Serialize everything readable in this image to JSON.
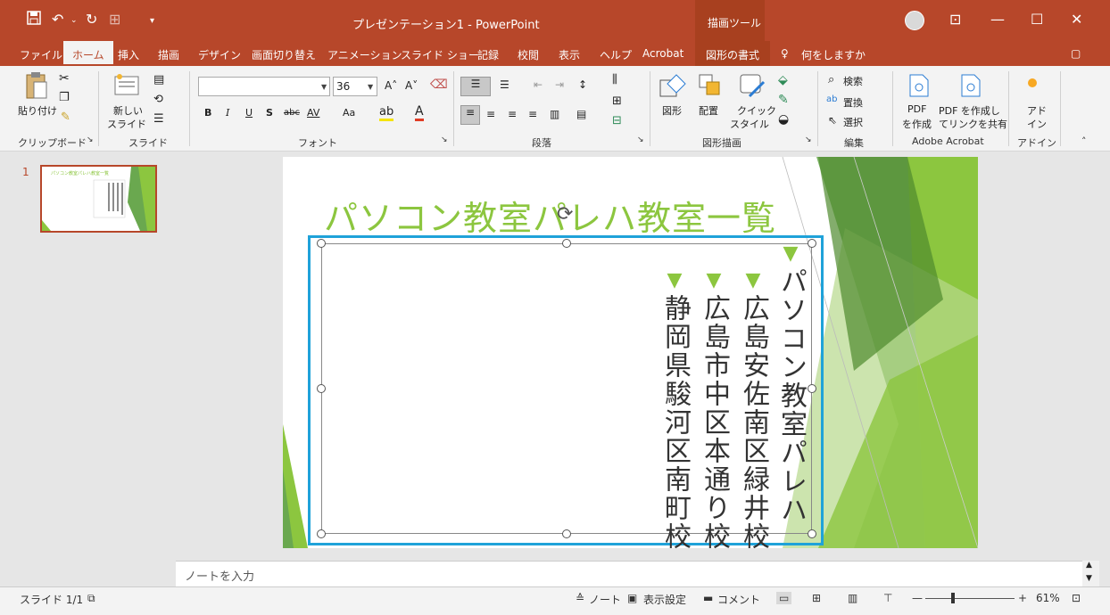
{
  "titlebar": {
    "title": "プレゼンテーション1 - PowerPoint",
    "tools_label": "描画ツール",
    "qat_save_icon": "save-icon",
    "qat_undo_icon": "undo-icon",
    "qat_redo_icon": "redo-icon",
    "minimize": "—",
    "maximize": "☐",
    "close": "✕"
  },
  "tabs": [
    {
      "label": "ファイル"
    },
    {
      "label": "ホーム"
    },
    {
      "label": "挿入"
    },
    {
      "label": "描画"
    },
    {
      "label": "デザイン"
    },
    {
      "label": "画面切り替え"
    },
    {
      "label": "アニメーション"
    },
    {
      "label": "スライド ショー"
    },
    {
      "label": "記録"
    },
    {
      "label": "校閲"
    },
    {
      "label": "表示"
    },
    {
      "label": "ヘルプ"
    },
    {
      "label": "Acrobat"
    },
    {
      "label": "図形の書式"
    },
    {
      "label": "何をしますか"
    }
  ],
  "ribbon": {
    "paste": "貼り付け",
    "new_slide_line1": "新しい",
    "new_slide_line2": "スライド",
    "font_size": "36",
    "bold": "B",
    "italic": "I",
    "underline": "U",
    "shadow": "S",
    "strike": "abc",
    "spacing": "AV",
    "case": "Aa",
    "shape": "図形",
    "arrange": "配置",
    "quick_style_line1": "クイック",
    "quick_style_line2": "スタイル",
    "find": "検索",
    "replace": "置換",
    "select": "選択",
    "pdf_create_line1": "PDF",
    "pdf_create_line2": "を作成",
    "pdf_share_line1": "PDF を作成し",
    "pdf_share_line2": "てリンクを共有",
    "addin_line1": "アド",
    "addin_line2": "イン",
    "groups": {
      "clipboard": "クリップボード",
      "slides": "スライド",
      "font": "フォント",
      "paragraph": "段落",
      "drawing": "図形描画",
      "editing": "編集",
      "acrobat": "Adobe Acrobat",
      "addins": "アドイン"
    }
  },
  "thumbnail": {
    "number": "1"
  },
  "slide": {
    "title": "パソコン教室パレハ教室一覧",
    "columns": [
      {
        "text": "パソコン教室パレハ",
        "bullet": "▼"
      },
      {
        "text": "広島安佐南区緑井校",
        "bullet": "▼"
      },
      {
        "text": "広島市中区本通り校",
        "bullet": "▼"
      },
      {
        "text": "静岡県駿河区南町校",
        "bullet": "▼"
      }
    ]
  },
  "notes": {
    "placeholder": "ノートを入力"
  },
  "status": {
    "slide_info": "スライド 1/1",
    "notes": "ノート",
    "display_settings": "表示設定",
    "comments": "コメント",
    "zoom_minus": "—",
    "zoom_plus": "+",
    "zoom": "61%"
  },
  "colors": {
    "accent": "#b7472a",
    "slide_green": "#8cc63f",
    "selection_blue": "#1fa2d9"
  }
}
